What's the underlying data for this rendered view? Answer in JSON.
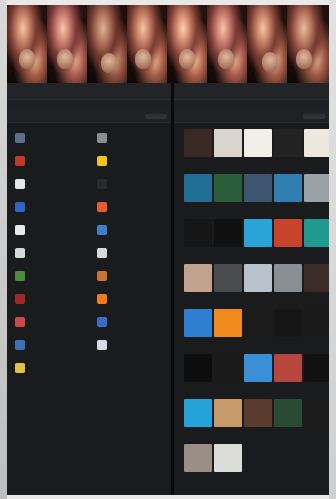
{
  "left_panel": {
    "title": "",
    "subtitle_tabs": [
      "",
      "",
      ""
    ],
    "filter_label": "",
    "section_label": ""
  },
  "right_panel": {
    "title": "",
    "subtitle_tabs": [
      "",
      "",
      ""
    ],
    "filter_label": "",
    "section_label": ""
  },
  "colors": {
    "frame_bg": "#0f0f10",
    "panel_bg": "#1a1b1d",
    "accent_blue": "#2c5e9f"
  },
  "left_apps": [
    {
      "label": "",
      "icon": "app-icon",
      "color": "#5a6f8e"
    },
    {
      "label": "",
      "icon": "app-icon",
      "color": "#8d8d8d"
    },
    {
      "label": "",
      "icon": "app-icon",
      "color": "#c03a2b"
    },
    {
      "label": "",
      "icon": "app-icon",
      "color": "#f0c419"
    },
    {
      "label": "",
      "icon": "app-icon",
      "color": "#e6e6e6"
    },
    {
      "label": "",
      "icon": "app-icon",
      "color": "#2b2b2b"
    },
    {
      "label": "",
      "icon": "app-icon",
      "color": "#2f66c2"
    },
    {
      "label": "",
      "icon": "app-icon",
      "color": "#e35d2e"
    },
    {
      "label": "",
      "icon": "app-icon",
      "color": "#e8e8e8"
    },
    {
      "label": "",
      "icon": "app-icon",
      "color": "#3d7fcc"
    },
    {
      "label": "",
      "icon": "app-icon",
      "color": "#d8d8d8"
    },
    {
      "label": "",
      "icon": "app-icon",
      "color": "#d9d9d9"
    },
    {
      "label": "",
      "icon": "app-icon",
      "color": "#4b8b3b"
    },
    {
      "label": "",
      "icon": "app-icon",
      "color": "#c8762d"
    },
    {
      "label": "",
      "icon": "app-icon",
      "color": "#9c2a2a"
    },
    {
      "label": "",
      "icon": "app-icon",
      "color": "#f07b1d"
    },
    {
      "label": "",
      "icon": "app-icon",
      "color": "#c94b4b"
    },
    {
      "label": "",
      "icon": "app-icon",
      "color": "#3a6cc8"
    },
    {
      "label": "",
      "icon": "app-icon",
      "color": "#3f6fb5"
    },
    {
      "label": "",
      "icon": "app-icon",
      "color": "#d7dbe6"
    },
    {
      "label": "",
      "icon": "app-icon",
      "color": "#e0c24a"
    }
  ],
  "right_cards": [
    {
      "color": "#3a2a26",
      "label": ""
    },
    {
      "color": "#d9d4cf",
      "label": ""
    },
    {
      "color": "#f1efe9",
      "label": ""
    },
    {
      "color": "#222222",
      "label": ""
    },
    {
      "color": "#ede8dc",
      "label": ""
    },
    {
      "color": "#1f6f96",
      "label": ""
    },
    {
      "color": "#2a5d3a",
      "label": ""
    },
    {
      "color": "#3f5470",
      "label": ""
    },
    {
      "color": "#2f7fb0",
      "label": ""
    },
    {
      "color": "#9aa0a6",
      "label": ""
    },
    {
      "color": "#151515",
      "label": ""
    },
    {
      "color": "#101010",
      "label": ""
    },
    {
      "color": "#2aa3d6",
      "label": ""
    },
    {
      "color": "#c8432c",
      "label": ""
    },
    {
      "color": "#1f9a8f",
      "label": ""
    },
    {
      "color": "#c2a48c",
      "label": ""
    },
    {
      "color": "#4a4b4f",
      "label": ""
    },
    {
      "color": "#b9c1ca",
      "label": ""
    },
    {
      "color": "#8a8f96",
      "label": ""
    },
    {
      "color": "#3b2c28",
      "label": ""
    },
    {
      "color": "#2e7fd0",
      "label": ""
    },
    {
      "color": "#f08a1c",
      "label": ""
    },
    {
      "color": "#1b1b1b",
      "label": ""
    },
    {
      "color": "#161616",
      "label": ""
    },
    {
      "color": "#1a1a1a",
      "label": ""
    },
    {
      "color": "#0d0d0d",
      "label": ""
    },
    {
      "color": "#1a1a1a",
      "label": ""
    },
    {
      "color": "#3a8fd6",
      "label": ""
    },
    {
      "color": "#b5473e",
      "label": ""
    },
    {
      "color": "#111111",
      "label": ""
    },
    {
      "color": "#24a3d8",
      "label": ""
    },
    {
      "color": "#c89a6a",
      "label": ""
    },
    {
      "color": "#5a3b2e",
      "label": ""
    },
    {
      "color": "#2b4a35",
      "label": ""
    },
    {
      "color": "#1b1b1b",
      "label": ""
    },
    {
      "color": "#9b8f85",
      "label": ""
    },
    {
      "color": "#dcdcd8",
      "label": ""
    }
  ]
}
